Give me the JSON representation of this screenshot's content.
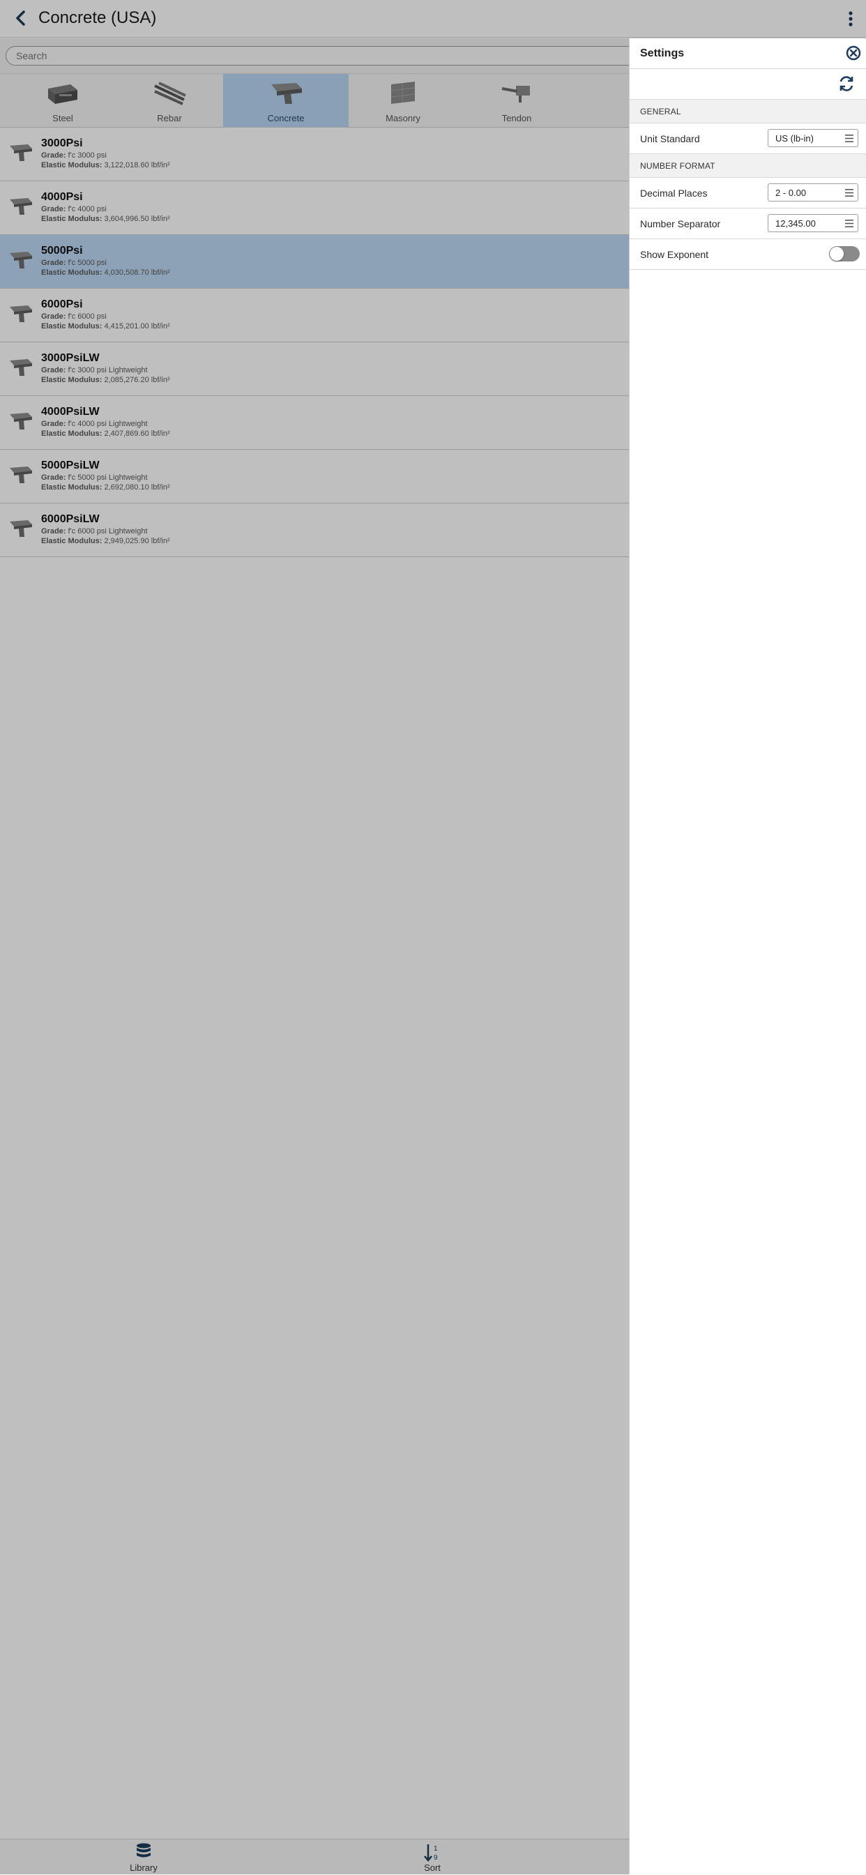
{
  "header": {
    "title": "Concrete (USA)"
  },
  "search": {
    "placeholder": "Search"
  },
  "categories": [
    {
      "label": "Steel",
      "icon": "steel-icon"
    },
    {
      "label": "Rebar",
      "icon": "rebar-icon"
    },
    {
      "label": "Concrete",
      "icon": "concrete-icon",
      "active": true
    },
    {
      "label": "Masonry",
      "icon": "masonry-icon"
    },
    {
      "label": "Tendon",
      "icon": "tendon-icon"
    }
  ],
  "materials": [
    {
      "name": "3000Psi",
      "grade_key": "Grade:",
      "grade": "f'c 3000 psi",
      "modulus_key": "Elastic Modulus:",
      "modulus": "3,122,018.60 lbf/in²"
    },
    {
      "name": "4000Psi",
      "grade_key": "Grade:",
      "grade": "f'c 4000 psi",
      "modulus_key": "Elastic Modulus:",
      "modulus": "3,604,996.50 lbf/in²"
    },
    {
      "name": "5000Psi",
      "grade_key": "Grade:",
      "grade": "f'c 5000 psi",
      "modulus_key": "Elastic Modulus:",
      "modulus": "4,030,508.70 lbf/in²",
      "selected": true
    },
    {
      "name": "6000Psi",
      "grade_key": "Grade:",
      "grade": "f'c 6000 psi",
      "modulus_key": "Elastic Modulus:",
      "modulus": "4,415,201.00 lbf/in²"
    },
    {
      "name": "3000PsiLW",
      "grade_key": "Grade:",
      "grade": "f'c 3000 psi Lightweight",
      "modulus_key": "Elastic Modulus:",
      "modulus": "2,085,276.20 lbf/in²"
    },
    {
      "name": "4000PsiLW",
      "grade_key": "Grade:",
      "grade": "f'c 4000 psi Lightweight",
      "modulus_key": "Elastic Modulus:",
      "modulus": "2,407,869.60 lbf/in²"
    },
    {
      "name": "5000PsiLW",
      "grade_key": "Grade:",
      "grade": "f'c 5000 psi Lightweight",
      "modulus_key": "Elastic Modulus:",
      "modulus": "2,692,080.10 lbf/in²"
    },
    {
      "name": "6000PsiLW",
      "grade_key": "Grade:",
      "grade": "f'c 6000 psi Lightweight",
      "modulus_key": "Elastic Modulus:",
      "modulus": "2,949,025.90 lbf/in²"
    }
  ],
  "bottom_tabs": [
    {
      "label": "Library",
      "icon": "database-icon"
    },
    {
      "label": "Sort",
      "icon": "sort-numeric-icon"
    }
  ],
  "settings": {
    "title": "Settings",
    "sections": {
      "general": "GENERAL",
      "number_format": "NUMBER FORMAT"
    },
    "unit_standard": {
      "label": "Unit Standard",
      "value": "US (lb-in)"
    },
    "decimal_places": {
      "label": "Decimal Places",
      "value": "2 - 0.00"
    },
    "number_separator": {
      "label": "Number Separator",
      "value": "12,345.00"
    },
    "show_exponent": {
      "label": "Show Exponent",
      "value": false
    }
  },
  "colors": {
    "accent": "#1d3b5c",
    "selected_row": "#bcd8f4",
    "overlay_tint": "#bdbdbd"
  }
}
